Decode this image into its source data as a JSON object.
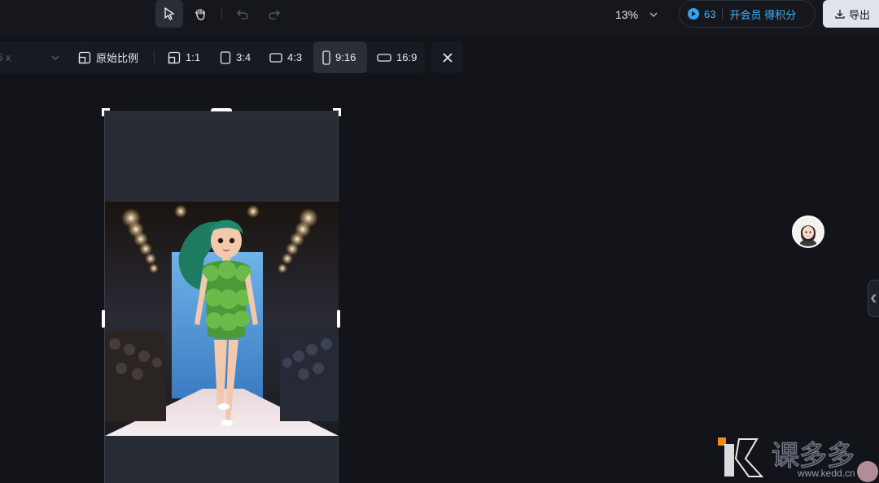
{
  "toolbar": {
    "select_tool": "select",
    "hand_tool": "hand",
    "undo": "undo",
    "redo": "redo"
  },
  "zoom": {
    "value": "13%"
  },
  "credits": {
    "count": "63",
    "vip_label": "开会员 得积分"
  },
  "export": {
    "label": "导出"
  },
  "ratio_bar": {
    "partial_label": "5 x",
    "original_label": "原始比例",
    "options": [
      {
        "label": "1:1"
      },
      {
        "label": "3:4"
      },
      {
        "label": "4:3"
      },
      {
        "label": "9:16",
        "selected": true
      },
      {
        "label": "16:9"
      }
    ]
  },
  "watermark": {
    "text": "课多多",
    "url": "www.kedd.cn"
  },
  "colors": {
    "background": "#12141a",
    "accent": "#3fb4ff",
    "panel": "#171a20",
    "selected": "#2a2e37"
  },
  "icons": [
    "cursor-icon",
    "hand-icon",
    "undo-icon",
    "redo-icon",
    "chevron-down-icon",
    "coin-icon",
    "download-icon",
    "original-ratio-icon",
    "close-icon",
    "collapse-icon"
  ]
}
